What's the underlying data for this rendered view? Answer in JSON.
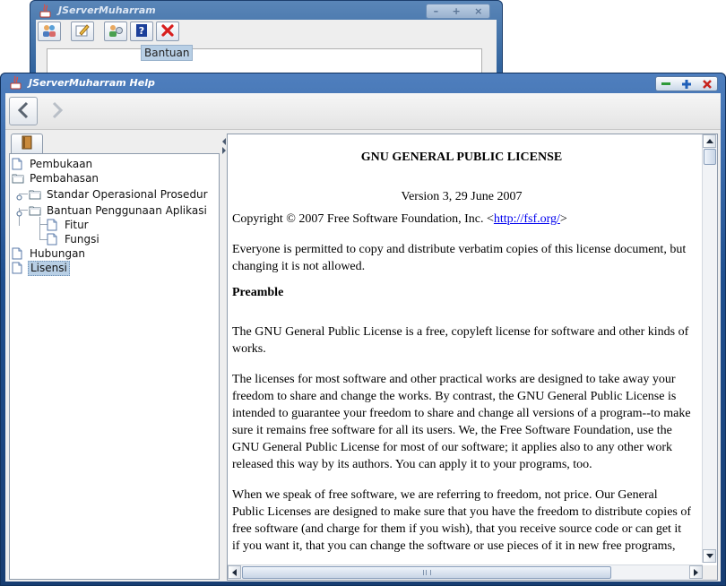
{
  "background_window": {
    "title": "JServerMuharram",
    "tooltip": "Bantuan",
    "toolbar_icons": [
      "users-icon",
      "edit-icon",
      "user-settings-icon",
      "help-icon",
      "close-red-icon"
    ]
  },
  "help_window": {
    "title": "JServerMuharram Help",
    "nav": {
      "back": "back-arrow-icon",
      "forward": "forward-arrow-icon"
    },
    "tree": [
      {
        "label": "Pembukaan",
        "type": "page",
        "level": 0
      },
      {
        "label": "Pembahasan",
        "type": "folder",
        "level": 0
      },
      {
        "label": "Standar Operasional Prosedur",
        "type": "folder",
        "level": 1
      },
      {
        "label": "Bantuan Penggunaan Aplikasi",
        "type": "folder",
        "level": 1
      },
      {
        "label": "Fitur",
        "type": "page",
        "level": 2
      },
      {
        "label": "Fungsi",
        "type": "page",
        "level": 2
      },
      {
        "label": "Hubungan",
        "type": "page",
        "level": 0
      },
      {
        "label": "Lisensi",
        "type": "page",
        "level": 0,
        "selected": true
      }
    ],
    "document": {
      "title": "GNU GENERAL PUBLIC LICENSE",
      "version": "Version 3, 29 June 2007",
      "copyright_prefix": "Copyright © 2007 Free Software Foundation, Inc. <",
      "copyright_link": "http://fsf.org/",
      "copyright_suffix": ">",
      "permission": "Everyone is permitted to copy and distribute verbatim copies of this license document, but changing it is not allowed.",
      "preamble_heading": "Preamble",
      "para1": "The GNU General Public License is a free, copyleft license for software and other kinds of works.",
      "para2": "The licenses for most software and other practical works are designed to take away your freedom to share and change the works. By contrast, the GNU General Public License is intended to guarantee your freedom to share and change all versions of a program--to make sure it remains free software for all its users. We, the Free Software Foundation, use the GNU General Public License for most of our software; it applies also to any other work released this way by its authors. You can apply it to your programs, too.",
      "para3": "When we speak of free software, we are referring to freedom, not price. Our General Public Licenses are designed to make sure that you have the freedom to distribute copies of free software (and charge for them if you wish), that you receive source code or can get it if you want it, that you can change the software or use pieces of it in new free programs,"
    }
  },
  "colors": {
    "titlebar": "#1f4f8f",
    "selection": "#b8cfe5",
    "link": "#0000ee"
  }
}
